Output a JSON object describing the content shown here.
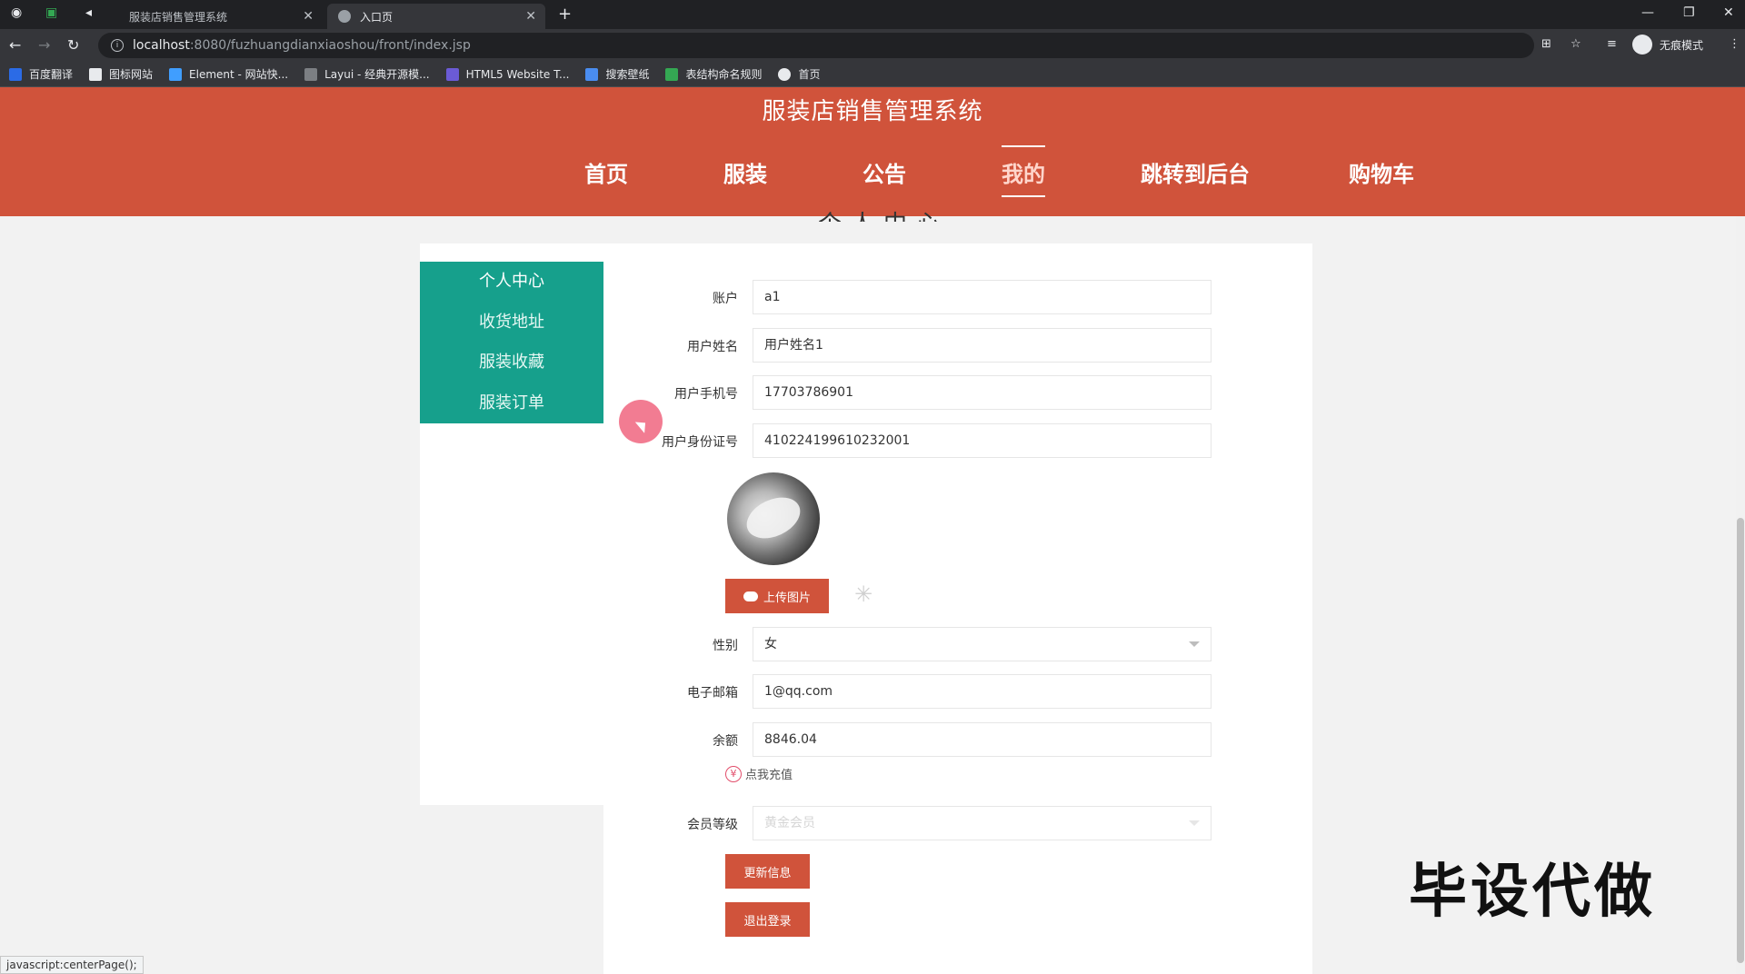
{
  "browser": {
    "tabs": [
      {
        "label": "服装店销售管理系统",
        "active": false
      },
      {
        "label": "入口页",
        "active": true
      }
    ],
    "url_host": "localhost",
    "url_path": ":8080/fuzhuangdianxiaoshou/front/index.jsp",
    "profile_label": "无痕模式",
    "bookmarks": [
      "百度翻译",
      "图标网站",
      "Element - 网站快...",
      "Layui - 经典开源模...",
      "HTML5 Website T...",
      "搜索壁纸",
      "表结构命名规则",
      "首页"
    ]
  },
  "site": {
    "title": "服装店销售管理系统",
    "nav": [
      {
        "label": "首页",
        "active": false
      },
      {
        "label": "服装",
        "active": false
      },
      {
        "label": "公告",
        "active": false
      },
      {
        "label": "我的",
        "active": true
      },
      {
        "label": "跳转到后台",
        "active": false
      },
      {
        "label": "购物车",
        "active": false
      }
    ],
    "section_heading": "个人中心"
  },
  "sidebar": {
    "items": [
      "个人中心",
      "收货地址",
      "服装收藏",
      "服装订单"
    ]
  },
  "form": {
    "account": {
      "label": "账户",
      "value": "a1"
    },
    "name": {
      "label": "用户姓名",
      "value": "用户姓名1"
    },
    "phone": {
      "label": "用户手机号",
      "value": "17703786901"
    },
    "idcard": {
      "label": "用户身份证号",
      "value": "410224199610232001"
    },
    "upload_label": "上传图片",
    "gender": {
      "label": "性别",
      "value": "女"
    },
    "email": {
      "label": "电子邮箱",
      "value": "1@qq.com"
    },
    "balance": {
      "label": "余额",
      "value": "8846.04"
    },
    "recharge_label": "点我充值",
    "vip": {
      "label": "会员等级",
      "value": "黄金会员"
    },
    "update_button": "更新信息",
    "logout_button": "退出登录"
  },
  "watermark": "毕设代做",
  "status_text": "javascript:centerPage();",
  "colors": {
    "brand_red": "#d0533b",
    "sidebar_teal": "#16a08c"
  }
}
